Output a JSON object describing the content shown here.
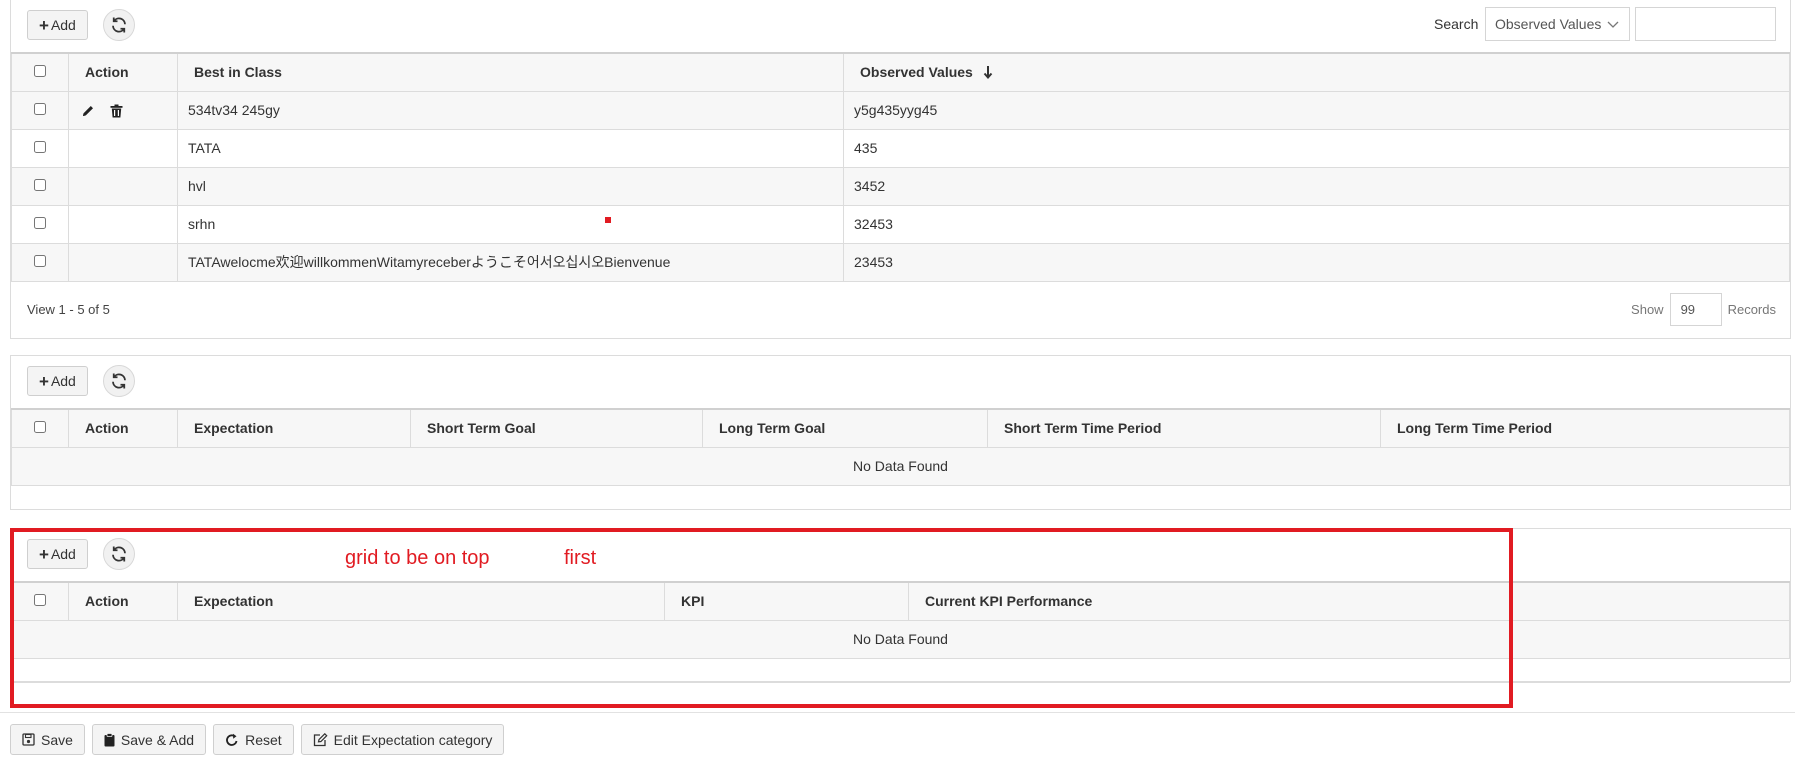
{
  "grid1": {
    "add_label": "Add",
    "search_label": "Search",
    "search_field": "Observed Values",
    "search_value": "",
    "columns": {
      "action": "Action",
      "best_in_class": "Best in Class",
      "observed_values": "Observed Values"
    },
    "rows": [
      {
        "best_in_class": "534tv34 245gy",
        "observed_values": "y5g435yyg45"
      },
      {
        "best_in_class": "TATA",
        "observed_values": "435"
      },
      {
        "best_in_class": "hvl",
        "observed_values": "3452"
      },
      {
        "best_in_class": "srhn",
        "observed_values": "32453"
      },
      {
        "best_in_class": "TATAwelocme欢迎willkommenWitamyreceberようこそ어서오십시오Bienvenue",
        "observed_values": "23453"
      }
    ],
    "footer": {
      "view_text": "View 1 - 5 of 5",
      "show_label": "Show",
      "show_value": "99",
      "records_label": "Records"
    }
  },
  "grid2": {
    "add_label": "Add",
    "columns": {
      "action": "Action",
      "expectation": "Expectation",
      "short_term_goal": "Short Term Goal",
      "long_term_goal": "Long Term Goal",
      "short_term_time_period": "Short Term Time Period",
      "long_term_time_period": "Long Term Time Period"
    },
    "no_data": "No Data Found"
  },
  "grid3": {
    "add_label": "Add",
    "columns": {
      "action": "Action",
      "expectation": "Expectation",
      "kpi": "KPI",
      "current_kpi_performance": "Current KPI Performance"
    },
    "no_data": "No Data Found"
  },
  "annotation": {
    "text_1": "grid to be on top",
    "text_2": "first",
    "color": "#e11b22"
  },
  "bottom_buttons": {
    "save": "Save",
    "save_add": "Save & Add",
    "reset": "Reset",
    "edit_category": "Edit Expectation category"
  }
}
